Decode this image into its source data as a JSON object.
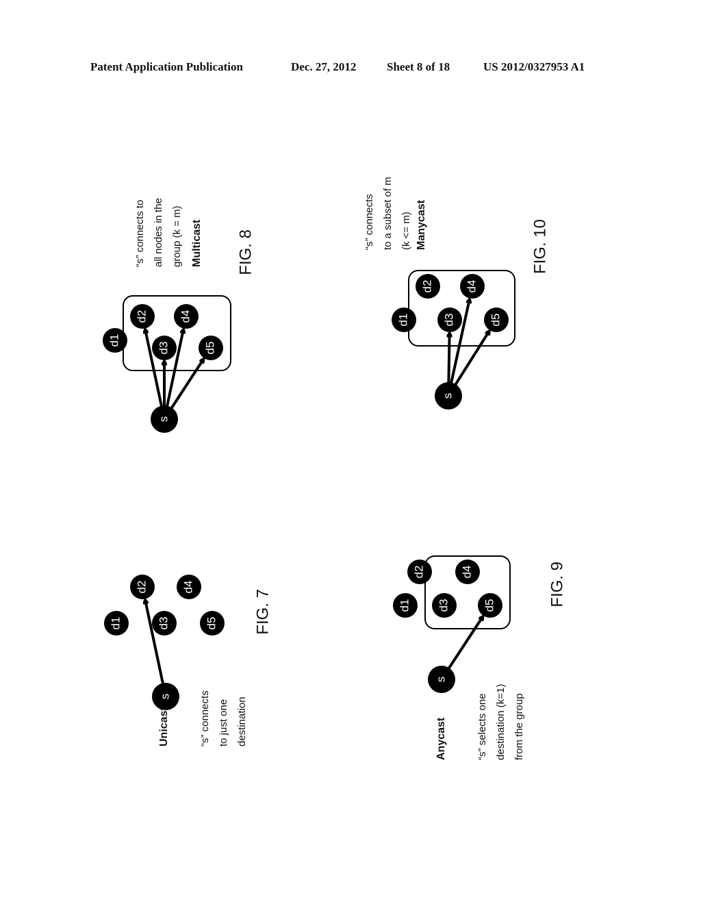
{
  "header": {
    "publication": "Patent Application Publication",
    "date": "Dec. 27, 2012",
    "sheet": "Sheet 8 of 18",
    "number": "US 2012/0327953 A1"
  },
  "figures": [
    {
      "id": "fig7",
      "caption": "FIG. 7",
      "title": "Unicast",
      "description": [
        "“s” connects",
        "to just one",
        "destination"
      ],
      "source": "s",
      "nodes": [
        "d1",
        "d2",
        "d3",
        "d4",
        "d5"
      ],
      "group": [],
      "edges": [
        [
          "s",
          "d2"
        ]
      ]
    },
    {
      "id": "fig8",
      "caption": "FIG. 8",
      "title": "Multicast",
      "description": [
        "“s” connects to",
        "all nodes in the",
        "group (k = m)"
      ],
      "source": "s",
      "nodes": [
        "d1",
        "d2",
        "d3",
        "d4",
        "d5"
      ],
      "group": [
        "d2",
        "d3",
        "d4",
        "d5"
      ],
      "edges": [
        [
          "s",
          "d2"
        ],
        [
          "s",
          "d3"
        ],
        [
          "s",
          "d4"
        ],
        [
          "s",
          "d5"
        ]
      ]
    },
    {
      "id": "fig9",
      "caption": "FIG. 9",
      "title": "Anycast",
      "description": [
        "“s” selects one",
        "destination (k=1)",
        "from the group"
      ],
      "source": "s",
      "nodes": [
        "d1",
        "d2",
        "d3",
        "d4",
        "d5"
      ],
      "group": [
        "d2",
        "d3",
        "d4",
        "d5"
      ],
      "edges": [
        [
          "s",
          "d5"
        ]
      ]
    },
    {
      "id": "fig10",
      "caption": "FIG. 10",
      "title": "Manycast",
      "description": [
        "“s” connects",
        "to a subset of m",
        "(k <= m)"
      ],
      "source": "s",
      "nodes": [
        "d1",
        "d2",
        "d3",
        "d4",
        "d5"
      ],
      "group": [
        "d2",
        "d3",
        "d4",
        "d5"
      ],
      "edges": [
        [
          "s",
          "d3"
        ],
        [
          "s",
          "d4"
        ],
        [
          "s",
          "d5"
        ]
      ]
    }
  ]
}
